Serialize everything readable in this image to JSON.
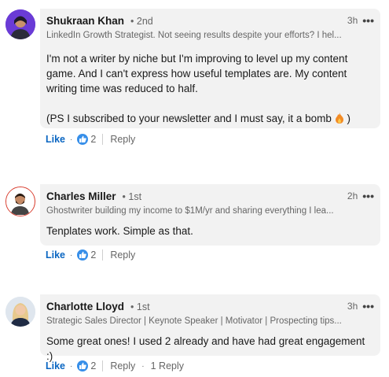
{
  "comments": [
    {
      "name": "Shukraan Khan",
      "degree": "• 2nd",
      "time": "3h",
      "headline": "LinkedIn Growth Strategist. Not seeing results despite your efforts? I hel...",
      "body": [
        "I'm not a writer by niche but I'm improving to level up my content game. And I can't express how useful templates are. My content writing time was reduced to half.",
        "(PS I subscribed to your newsletter and I must say, it a bomb"
      ],
      "body_suffix": ")",
      "like_label": "Like",
      "reaction_count": "2",
      "reply_label": "Reply"
    },
    {
      "name": "Charles Miller",
      "degree": "• 1st",
      "time": "2h",
      "headline": "Ghostwriter building my income to $1M/yr and sharing everything I lea...",
      "body": [
        "Tenplates work. Simple as that."
      ],
      "like_label": "Like",
      "reaction_count": "2",
      "reply_label": "Reply"
    },
    {
      "name": "Charlotte Lloyd",
      "degree": "• 1st",
      "time": "3h",
      "headline": "Strategic Sales Director | Keynote Speaker | Motivator | Prospecting tips...",
      "body": [
        "Some great ones! I used 2 already and have had great engagement :)"
      ],
      "like_label": "Like",
      "reaction_count": "2",
      "reply_label": "Reply",
      "replies_label": "1 Reply"
    }
  ],
  "icons": {
    "more": "more-options-icon",
    "reaction": "thumbs-up-reaction-icon",
    "emoji": "fire-emoji-icon"
  },
  "colors": {
    "accent": "#0a66c2",
    "bubble": "#f2f2f2",
    "reaction": "#378fe9"
  }
}
